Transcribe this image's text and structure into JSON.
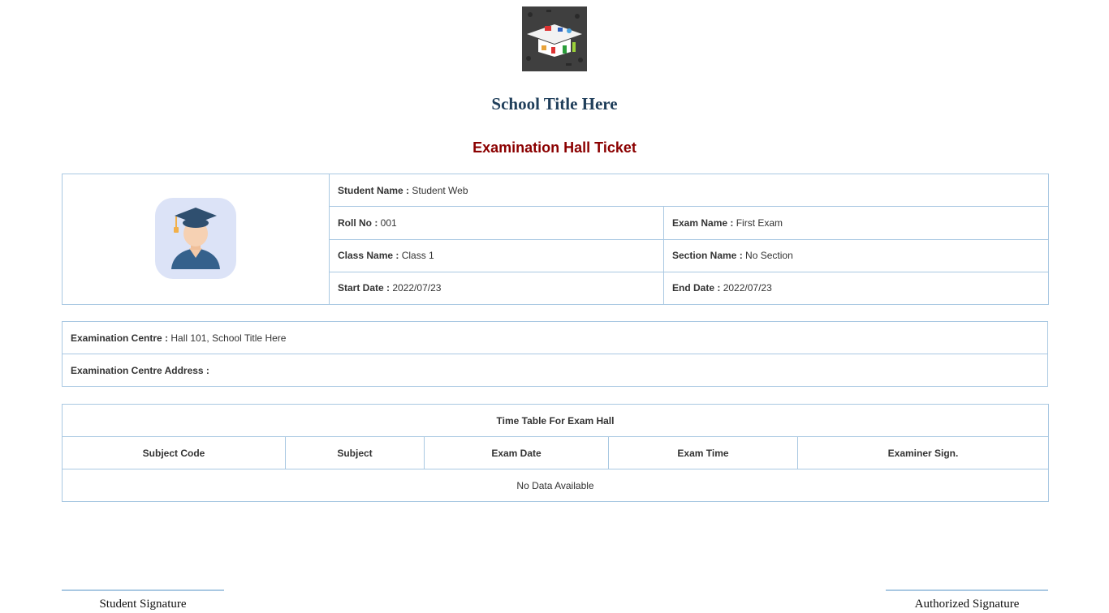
{
  "header": {
    "logo_icon": "graduation-cap-logo",
    "school_title": "School Title Here",
    "ticket_title": "Examination Hall Ticket"
  },
  "student": {
    "photo_icon": "student-avatar-icon",
    "name_label": "Student Name :",
    "name_value": "Student Web",
    "roll_label": "Roll No :",
    "roll_value": "001",
    "exam_label": "Exam Name :",
    "exam_value": "First Exam",
    "class_label": "Class Name :",
    "class_value": "Class 1",
    "section_label": "Section Name :",
    "section_value": "No Section",
    "start_label": "Start Date :",
    "start_value": "2022/07/23",
    "end_label": "End Date :",
    "end_value": "2022/07/23"
  },
  "centre": {
    "centre_label": "Examination Centre :",
    "centre_value": "Hall 101, School Title Here",
    "address_label": "Examination Centre Address :",
    "address_value": ""
  },
  "timetable": {
    "title": "Time Table For Exam Hall",
    "columns": [
      "Subject Code",
      "Subject",
      "Exam Date",
      "Exam Time",
      "Examiner Sign."
    ],
    "empty_text": "No Data Available"
  },
  "signatures": {
    "student": "Student Signature",
    "authorized": "Authorized Signature"
  },
  "colors": {
    "border": "#a9c8e2",
    "school_title": "#1f3e5a",
    "ticket_title": "#8b0000",
    "avatar_bg": "#dce3f7"
  }
}
